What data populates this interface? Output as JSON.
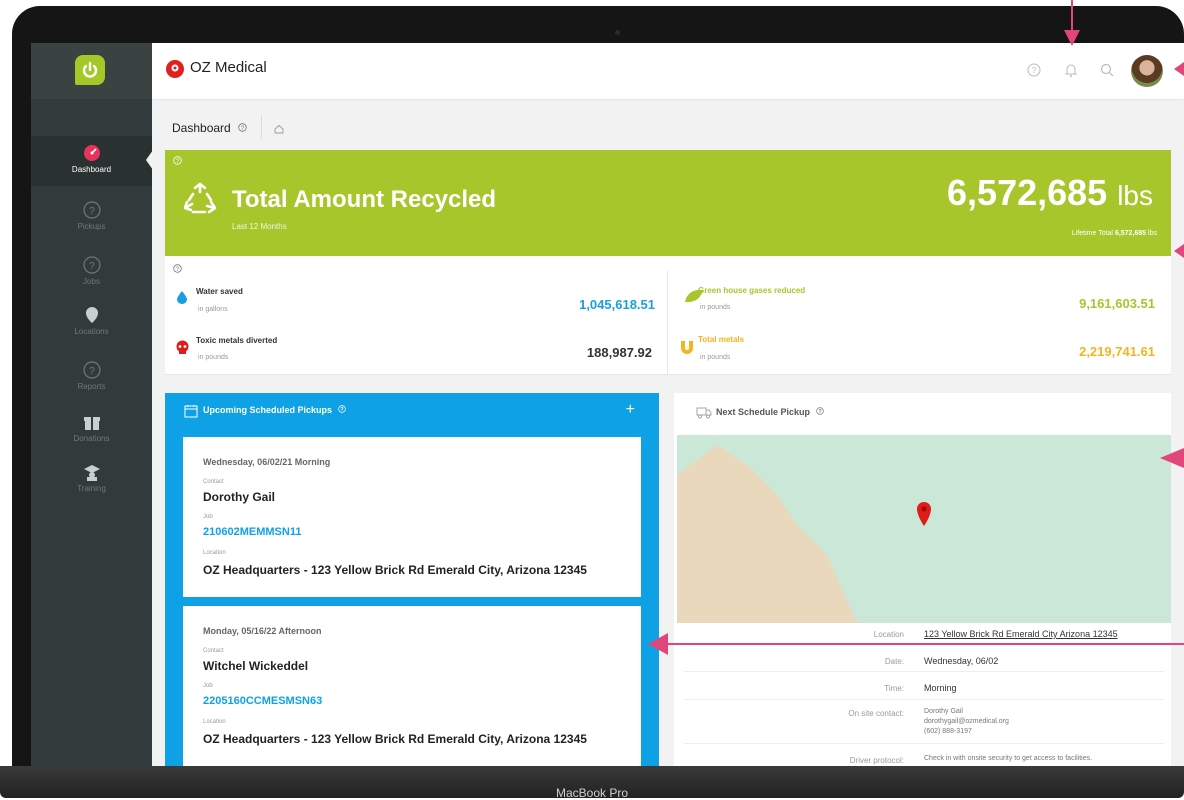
{
  "device": {
    "label": "MacBook Pro"
  },
  "app": {
    "brand_name": "OZ Medical"
  },
  "sidebar": {
    "items": [
      {
        "label": "Dashboard",
        "icon": "dashboard-gauge-icon"
      },
      {
        "label": "Pickups",
        "icon": "help-circle-icon"
      },
      {
        "label": "Jobs",
        "icon": "help-circle-icon"
      },
      {
        "label": "Locations",
        "icon": "map-pin-icon"
      },
      {
        "label": "Reports",
        "icon": "help-circle-icon"
      },
      {
        "label": "Donations",
        "icon": "gift-icon"
      },
      {
        "label": "Training",
        "icon": "graduation-cap-icon"
      }
    ]
  },
  "breadcrumb": {
    "title": "Dashboard"
  },
  "hero": {
    "title": "Total Amount Recycled",
    "subtitle": "Last 12 Months",
    "value": "6,572,685",
    "unit": "lbs",
    "lifetime_label": "Lifetime Total",
    "lifetime_value": "6,572,685",
    "lifetime_unit": "lbs",
    "color": "#a6c62c"
  },
  "stats": {
    "water": {
      "label": "Water saved",
      "unit": "in gallons",
      "value": "1,045,618.51",
      "color": "#1b9de2"
    },
    "greenhouse": {
      "label": "Green house gases reduced",
      "unit": "in pounds",
      "value": "9,161,603.51",
      "color": "#a6c62c"
    },
    "toxic": {
      "label": "Toxic metals diverted",
      "unit": "in pounds",
      "value": "188,987.92",
      "color": "#e01b1b"
    },
    "metals": {
      "label": "Total metals",
      "unit": "in pounds",
      "value": "2,219,741.61",
      "color": "#f5b421"
    }
  },
  "pickups": {
    "title": "Upcoming Scheduled Pickups",
    "contact_label": "Contact",
    "job_label": "Job",
    "location_label": "Location",
    "items": [
      {
        "date": "Wednesday, 06/02/21 Morning",
        "contact": "Dorothy Gail",
        "job": "210602MEMMSN11",
        "location": "OZ Headquarters - 123 Yellow Brick Rd Emerald City, Arizona 12345"
      },
      {
        "date": "Monday, 05/16/22 Afternoon",
        "contact": "Witchel Wickeddel",
        "job": "2205160CCMESMSN63",
        "location": "OZ Headquarters - 123 Yellow Brick Rd Emerald City, Arizona 12345"
      }
    ]
  },
  "next_pickup": {
    "title": "Next Schedule Pickup",
    "location_label": "Location",
    "location_value": "123 Yellow Brick Rd Emerald City Arizona 12345",
    "date_label": "Date:",
    "date_value": "Wednesday, 06/02",
    "time_label": "Time:",
    "time_value": "Morning",
    "contact_label": "On site contact:",
    "contact_name": "Dorothy Gail",
    "contact_email": "dorothygail@ozmedical.org",
    "contact_phone": "(602) 888-3197",
    "protocol_label": "Driver protocol:",
    "protocol_value": "Check in with onsite security to get access to facilities."
  }
}
